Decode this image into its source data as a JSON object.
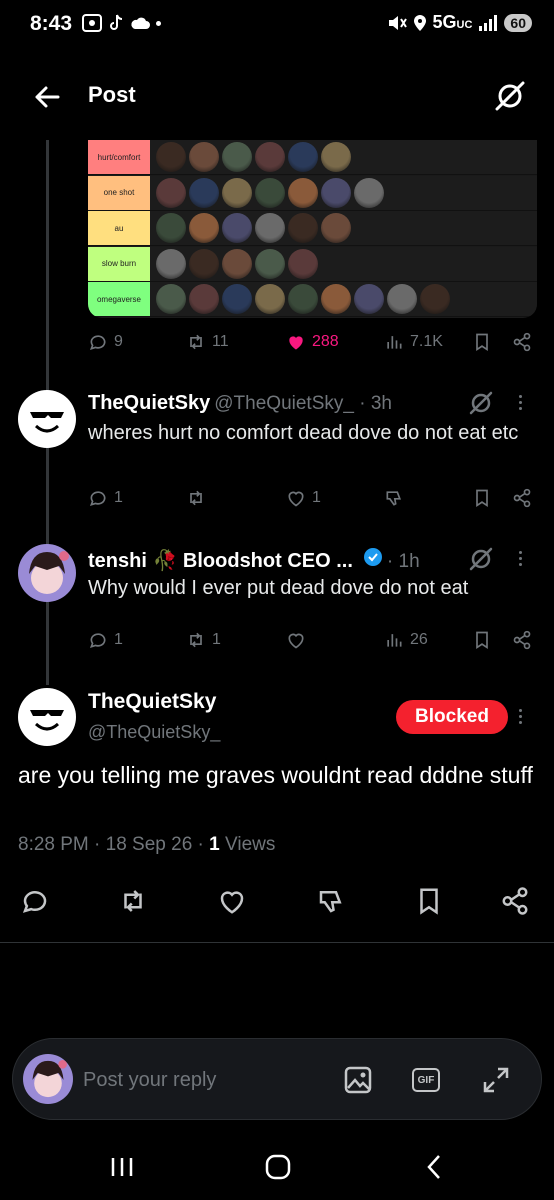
{
  "status_bar": {
    "time": "8:43",
    "network": "5G",
    "network_sub": "UC",
    "battery": "60"
  },
  "header": {
    "title": "Post"
  },
  "tierlist": {
    "rows": [
      {
        "label": "hurt/comfort",
        "color": "#ff7f7f",
        "count": 6
      },
      {
        "label": "one shot",
        "color": "#ffbf7f",
        "count": 7
      },
      {
        "label": "au",
        "color": "#ffdf7f",
        "count": 6
      },
      {
        "label": "slow burn",
        "color": "#bfff7f",
        "count": 5
      },
      {
        "label": "omegaverse",
        "color": "#7fff7f",
        "count": 9
      }
    ]
  },
  "tier_post_actions": {
    "replies": "9",
    "reposts": "11",
    "likes": "288",
    "views": "7.1K"
  },
  "reply1": {
    "name": "TheQuietSky",
    "handle": "@TheQuietSky_ · 3h",
    "text": "wheres hurt no comfort dead dove do not eat etc",
    "replies": "1",
    "likes": "1"
  },
  "reply2": {
    "name": "tenshi 🥀 Bloodshot CEO ...",
    "time": "· 1h",
    "text": "Why would I ever put dead dove do not eat",
    "replies": "1",
    "reposts": "1",
    "views": "26"
  },
  "main_post": {
    "name": "TheQuietSky",
    "handle": "@TheQuietSky_",
    "blocked_label": "Blocked",
    "text": "are you telling me graves wouldnt read dddne stuff",
    "time": "8:28 PM · 18 Sep 26 · ",
    "views_count": "1",
    "views_label": " Views"
  },
  "composer": {
    "placeholder": "Post your reply",
    "gif_label": "GIF"
  },
  "colors": {
    "like": "#f91880",
    "blocked": "#f4212e",
    "verified": "#1d9bf0",
    "muted": "#71767b"
  }
}
